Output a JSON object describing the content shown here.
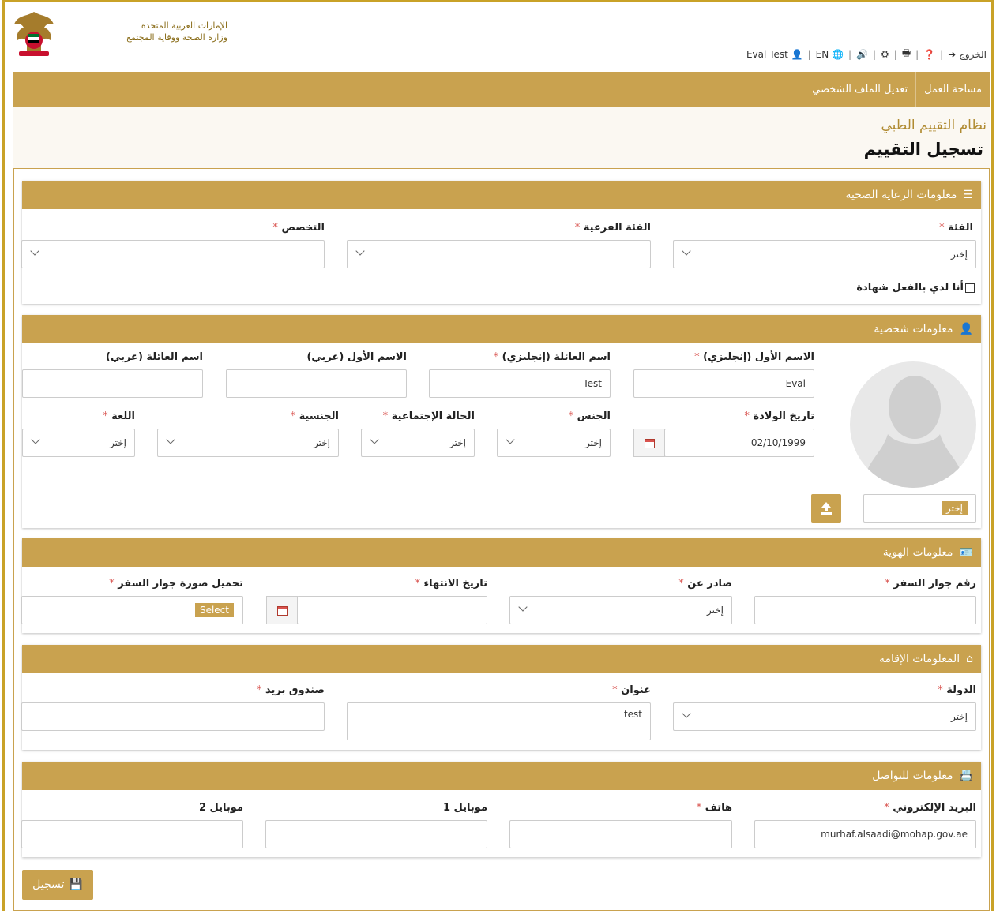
{
  "header": {
    "ministry_line1": "الإمارات العربية المتحدة",
    "ministry_line2": "وزارة الصحة ووقاية المجتمع",
    "user_name": "Eval Test",
    "language": "EN",
    "logout_label": "الخروج"
  },
  "nav": {
    "items": [
      {
        "label": "مساحة العمل"
      },
      {
        "label": "تعديل الملف الشخصي"
      }
    ]
  },
  "page": {
    "system_name": "نظام التقييم الطبي",
    "title": "تسجيل التقييم"
  },
  "healthcare": {
    "title": "معلومات الرعاية الصحية",
    "category_label": "الفئة",
    "category_value": "إختر",
    "subcategory_label": "الفئة الفرعية",
    "specialty_label": "التخصص",
    "certificate_label": "أنا لدي بالفعل شهادة"
  },
  "personal": {
    "title": "معلومات شخصية",
    "first_name_en_label": "الاسم الأول (إنجليزي)",
    "first_name_en_value": "Eval",
    "last_name_en_label": "اسم العائلة (إنجليزي)",
    "last_name_en_value": "Test",
    "first_name_ar_label": "الاسم الأول (عربي)",
    "last_name_ar_label": "اسم العائلة (عربي)",
    "dob_label": "تاريخ الولادة",
    "dob_value": "02/10/1999",
    "gender_label": "الجنس",
    "gender_value": "إختر",
    "marital_label": "الحالة الإجتماعية",
    "marital_value": "إختر",
    "nationality_label": "الجنسية",
    "nationality_value": "إختر",
    "language_label": "اللغة",
    "language_value": "إختر",
    "photo_choose": "إختر"
  },
  "identity": {
    "title": "معلومات الهوية",
    "passport_no_label": "رقم جواز السفر",
    "issued_by_label": "صادر عن",
    "issued_by_value": "إختر",
    "expiry_label": "تاريخ الانتهاء",
    "passport_upload_label": "تحميل صورة جواز السفر",
    "select_button": "Select"
  },
  "residence": {
    "title": "المعلومات الإقامة",
    "country_label": "الدولة",
    "country_value": "إختر",
    "address_label": "عنوان",
    "address_value": "test",
    "pobox_label": "صندوق بريد"
  },
  "contact": {
    "title": "معلومات للتواصل",
    "email_label": "البريد الإلكتروني",
    "email_value": "murhaf.alsaadi@mohap.gov.ae",
    "phone_label": "هاتف",
    "mobile1_label": "موبايل 1",
    "mobile2_label": "موبايل 2"
  },
  "actions": {
    "submit_label": "تسجيل"
  },
  "colors": {
    "gold": "#c9a24f",
    "required": "#d9534f"
  }
}
